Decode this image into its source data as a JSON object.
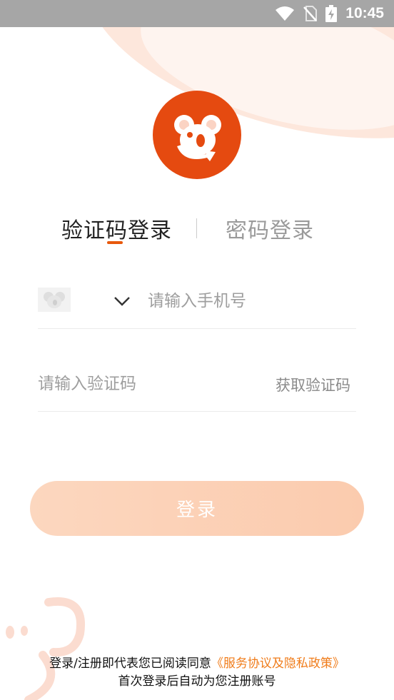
{
  "status_bar": {
    "time": "10:45",
    "icons": [
      "wifi-icon",
      "no-sim-icon",
      "battery-charging-icon"
    ]
  },
  "colors": {
    "brand": "#e54a10",
    "accent": "#e8590c",
    "link": "#f07c1a",
    "button_bg": "#fcd7bf"
  },
  "tabs": {
    "sms_login": "验证码登录",
    "password_login": "密码登录",
    "active": "sms_login"
  },
  "phone": {
    "placeholder": "请输入手机号",
    "value": ""
  },
  "code": {
    "placeholder": "请输入验证码",
    "value": "",
    "get_code_label": "获取验证码"
  },
  "login_button": {
    "label": "登录"
  },
  "agreement": {
    "prefix": "登录/注册即代表您已阅读同意",
    "policy_link": "《服务协议及隐私政策》",
    "note": "首次登录后自动为您注册账号"
  }
}
